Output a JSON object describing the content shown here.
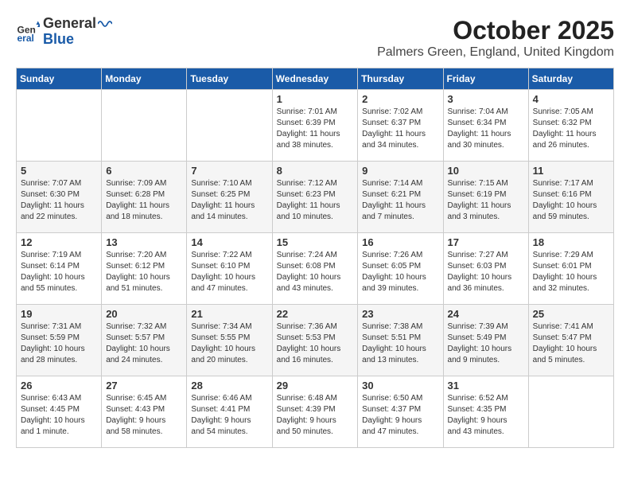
{
  "header": {
    "logo_line1": "General",
    "logo_line2": "Blue",
    "month_title": "October 2025",
    "location": "Palmers Green, England, United Kingdom"
  },
  "weekdays": [
    "Sunday",
    "Monday",
    "Tuesday",
    "Wednesday",
    "Thursday",
    "Friday",
    "Saturday"
  ],
  "weeks": [
    [
      {
        "day": "",
        "info": ""
      },
      {
        "day": "",
        "info": ""
      },
      {
        "day": "",
        "info": ""
      },
      {
        "day": "1",
        "info": "Sunrise: 7:01 AM\nSunset: 6:39 PM\nDaylight: 11 hours\nand 38 minutes."
      },
      {
        "day": "2",
        "info": "Sunrise: 7:02 AM\nSunset: 6:37 PM\nDaylight: 11 hours\nand 34 minutes."
      },
      {
        "day": "3",
        "info": "Sunrise: 7:04 AM\nSunset: 6:34 PM\nDaylight: 11 hours\nand 30 minutes."
      },
      {
        "day": "4",
        "info": "Sunrise: 7:05 AM\nSunset: 6:32 PM\nDaylight: 11 hours\nand 26 minutes."
      }
    ],
    [
      {
        "day": "5",
        "info": "Sunrise: 7:07 AM\nSunset: 6:30 PM\nDaylight: 11 hours\nand 22 minutes."
      },
      {
        "day": "6",
        "info": "Sunrise: 7:09 AM\nSunset: 6:28 PM\nDaylight: 11 hours\nand 18 minutes."
      },
      {
        "day": "7",
        "info": "Sunrise: 7:10 AM\nSunset: 6:25 PM\nDaylight: 11 hours\nand 14 minutes."
      },
      {
        "day": "8",
        "info": "Sunrise: 7:12 AM\nSunset: 6:23 PM\nDaylight: 11 hours\nand 10 minutes."
      },
      {
        "day": "9",
        "info": "Sunrise: 7:14 AM\nSunset: 6:21 PM\nDaylight: 11 hours\nand 7 minutes."
      },
      {
        "day": "10",
        "info": "Sunrise: 7:15 AM\nSunset: 6:19 PM\nDaylight: 11 hours\nand 3 minutes."
      },
      {
        "day": "11",
        "info": "Sunrise: 7:17 AM\nSunset: 6:16 PM\nDaylight: 10 hours\nand 59 minutes."
      }
    ],
    [
      {
        "day": "12",
        "info": "Sunrise: 7:19 AM\nSunset: 6:14 PM\nDaylight: 10 hours\nand 55 minutes."
      },
      {
        "day": "13",
        "info": "Sunrise: 7:20 AM\nSunset: 6:12 PM\nDaylight: 10 hours\nand 51 minutes."
      },
      {
        "day": "14",
        "info": "Sunrise: 7:22 AM\nSunset: 6:10 PM\nDaylight: 10 hours\nand 47 minutes."
      },
      {
        "day": "15",
        "info": "Sunrise: 7:24 AM\nSunset: 6:08 PM\nDaylight: 10 hours\nand 43 minutes."
      },
      {
        "day": "16",
        "info": "Sunrise: 7:26 AM\nSunset: 6:05 PM\nDaylight: 10 hours\nand 39 minutes."
      },
      {
        "day": "17",
        "info": "Sunrise: 7:27 AM\nSunset: 6:03 PM\nDaylight: 10 hours\nand 36 minutes."
      },
      {
        "day": "18",
        "info": "Sunrise: 7:29 AM\nSunset: 6:01 PM\nDaylight: 10 hours\nand 32 minutes."
      }
    ],
    [
      {
        "day": "19",
        "info": "Sunrise: 7:31 AM\nSunset: 5:59 PM\nDaylight: 10 hours\nand 28 minutes."
      },
      {
        "day": "20",
        "info": "Sunrise: 7:32 AM\nSunset: 5:57 PM\nDaylight: 10 hours\nand 24 minutes."
      },
      {
        "day": "21",
        "info": "Sunrise: 7:34 AM\nSunset: 5:55 PM\nDaylight: 10 hours\nand 20 minutes."
      },
      {
        "day": "22",
        "info": "Sunrise: 7:36 AM\nSunset: 5:53 PM\nDaylight: 10 hours\nand 16 minutes."
      },
      {
        "day": "23",
        "info": "Sunrise: 7:38 AM\nSunset: 5:51 PM\nDaylight: 10 hours\nand 13 minutes."
      },
      {
        "day": "24",
        "info": "Sunrise: 7:39 AM\nSunset: 5:49 PM\nDaylight: 10 hours\nand 9 minutes."
      },
      {
        "day": "25",
        "info": "Sunrise: 7:41 AM\nSunset: 5:47 PM\nDaylight: 10 hours\nand 5 minutes."
      }
    ],
    [
      {
        "day": "26",
        "info": "Sunrise: 6:43 AM\nSunset: 4:45 PM\nDaylight: 10 hours\nand 1 minute."
      },
      {
        "day": "27",
        "info": "Sunrise: 6:45 AM\nSunset: 4:43 PM\nDaylight: 9 hours\nand 58 minutes."
      },
      {
        "day": "28",
        "info": "Sunrise: 6:46 AM\nSunset: 4:41 PM\nDaylight: 9 hours\nand 54 minutes."
      },
      {
        "day": "29",
        "info": "Sunrise: 6:48 AM\nSunset: 4:39 PM\nDaylight: 9 hours\nand 50 minutes."
      },
      {
        "day": "30",
        "info": "Sunrise: 6:50 AM\nSunset: 4:37 PM\nDaylight: 9 hours\nand 47 minutes."
      },
      {
        "day": "31",
        "info": "Sunrise: 6:52 AM\nSunset: 4:35 PM\nDaylight: 9 hours\nand 43 minutes."
      },
      {
        "day": "",
        "info": ""
      }
    ]
  ]
}
